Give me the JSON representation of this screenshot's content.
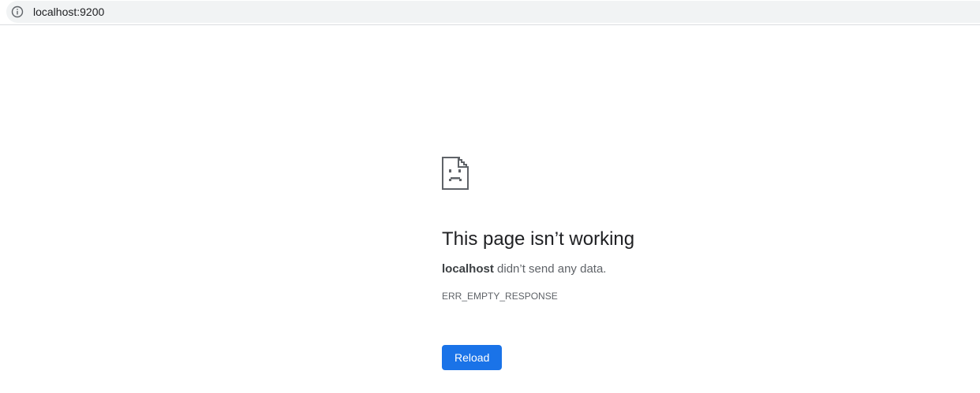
{
  "address_bar": {
    "url": "localhost:9200",
    "icon": "info-icon"
  },
  "error": {
    "icon": "sad-page-icon",
    "heading": "This page isn’t working",
    "host": "localhost",
    "message_suffix": " didn’t send any data.",
    "code": "ERR_EMPTY_RESPONSE",
    "reload_label": "Reload"
  },
  "colors": {
    "accent": "#1a73e8",
    "heading": "#202124",
    "text": "#5f6368"
  }
}
